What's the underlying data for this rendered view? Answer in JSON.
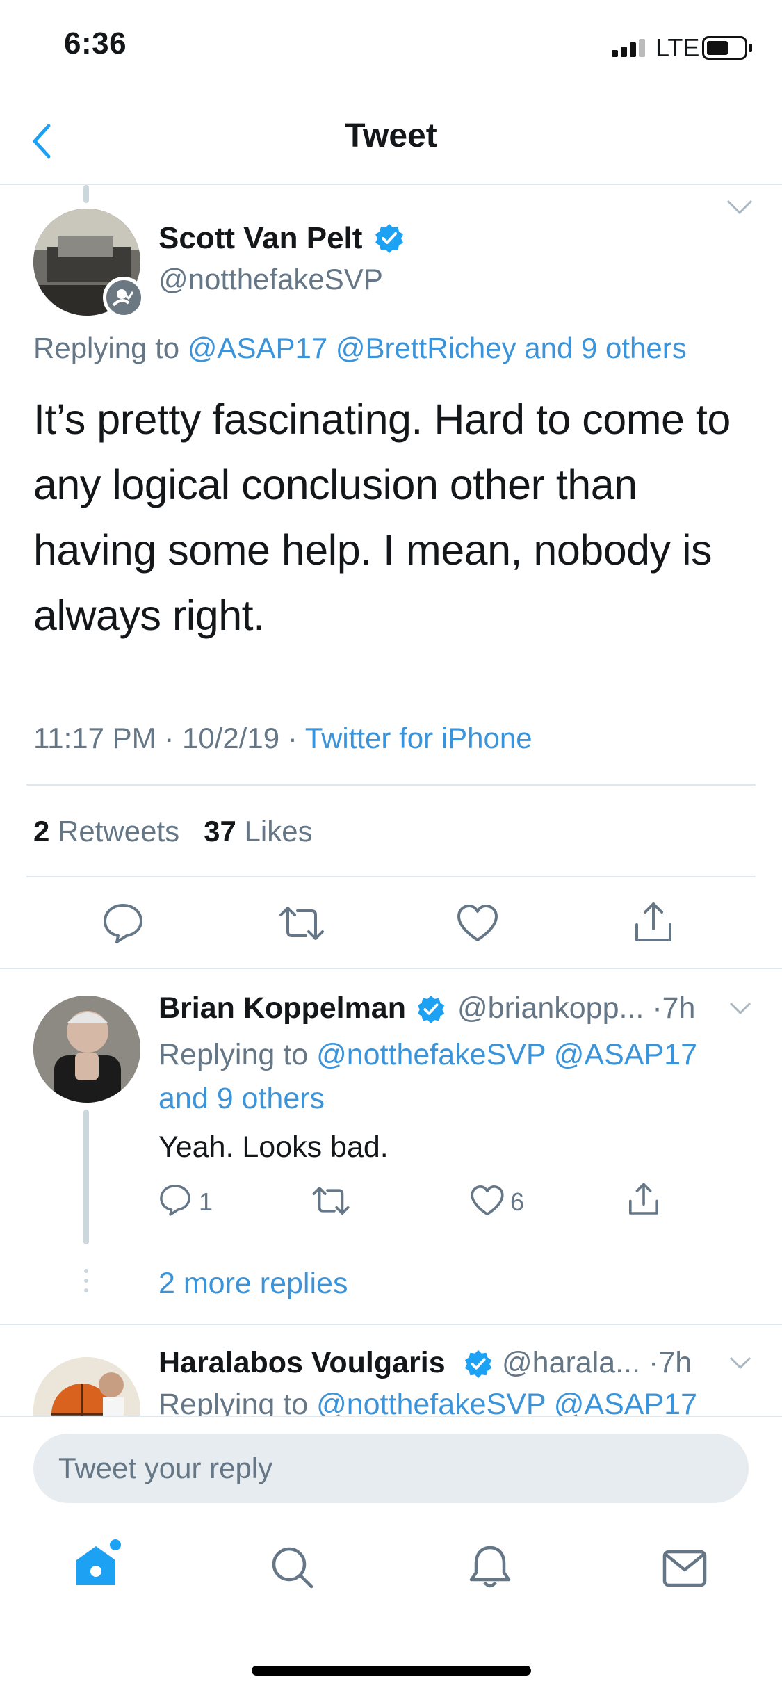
{
  "status_bar": {
    "time": "6:36",
    "network": "LTE"
  },
  "nav": {
    "title": "Tweet"
  },
  "main_tweet": {
    "name": "Scott Van Pelt",
    "handle": "@notthefakeSVP",
    "replying_prefix": "Replying to",
    "replying_users": "@ASAP17 @BrettRichey and 9 others",
    "text": "It’s pretty fascinating. Hard to come to any logical conclusion other than having some help. I mean, nobody is always right.",
    "time": "11:17 PM",
    "date": "10/2/19",
    "source": "Twitter for iPhone",
    "retweet_count": "2",
    "retweet_label": "Retweets",
    "like_count": "37",
    "like_label": "Likes"
  },
  "replies": [
    {
      "name": "Brian Koppelman",
      "handle": "@briankopp...",
      "age": "7h",
      "replying_prefix": "Replying to",
      "replying_users": "@notthefakeSVP @ASAP17 and 9 others",
      "text": "Yeah. Looks bad.",
      "reply_count": "1",
      "like_count": "6",
      "more_replies": "2 more replies"
    },
    {
      "name": "Haralabos Voulgaris",
      "handle": "@harala...",
      "age": "7h",
      "replying_prefix": "Replying to",
      "replying_users": "@notthefakeSVP @ASAP17"
    }
  ],
  "compose": {
    "placeholder": "Tweet your reply"
  },
  "tab_bar": {
    "items": [
      "home-icon",
      "search-icon",
      "notifications-icon",
      "messages-icon"
    ]
  },
  "colors": {
    "accent": "#1da1f2",
    "link": "#3b94d9",
    "secondary_text": "#657786",
    "divider": "#e1e8ed"
  }
}
